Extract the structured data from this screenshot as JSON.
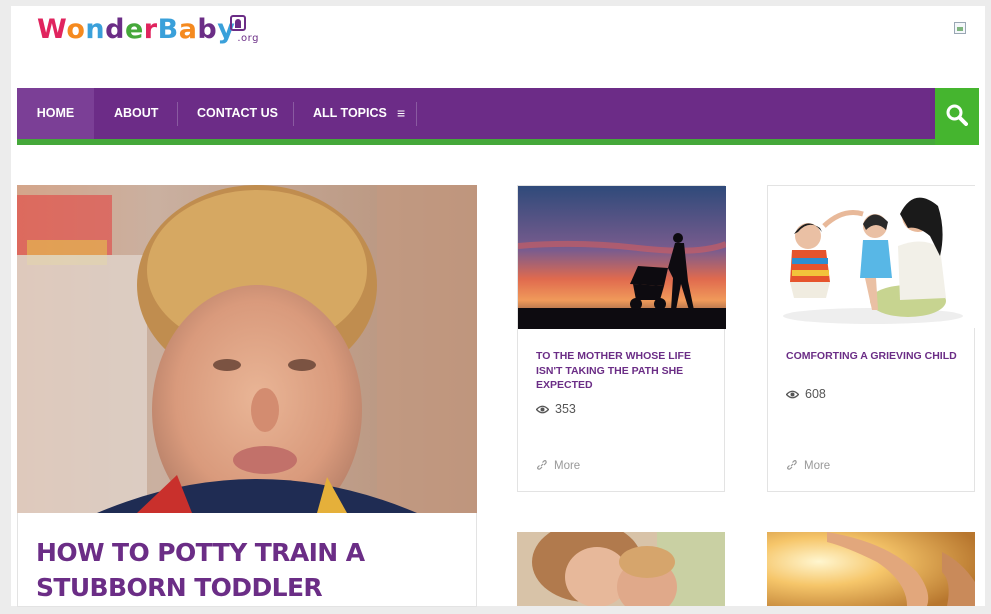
{
  "brand": {
    "logo_text": "WonderBaby",
    "logo_suffix": ".org",
    "logo_colors": [
      "#e0245e",
      "#f58a1f",
      "#3aa0da",
      "#6b2d86",
      "#45a83a"
    ]
  },
  "nav": {
    "items": [
      {
        "label": "HOME",
        "active": true
      },
      {
        "label": "ABOUT"
      },
      {
        "label": "CONTACT US"
      },
      {
        "label": "ALL TOPICS"
      }
    ],
    "menu_icon": "≡",
    "search_icon": "search-icon"
  },
  "featured": {
    "title": "HOW TO POTTY TRAIN A STUBBORN TODDLER"
  },
  "cards": [
    {
      "title": "TO THE MOTHER WHOSE LIFE ISN'T TAKING THE PATH SHE EXPECTED",
      "views": "353",
      "more": "More"
    },
    {
      "title": "COMFORTING A GRIEVING CHILD",
      "views": "608",
      "more": "More"
    }
  ],
  "colors": {
    "purple": "#6c2c87",
    "green": "#45a83a",
    "search_green": "#45b52f"
  }
}
